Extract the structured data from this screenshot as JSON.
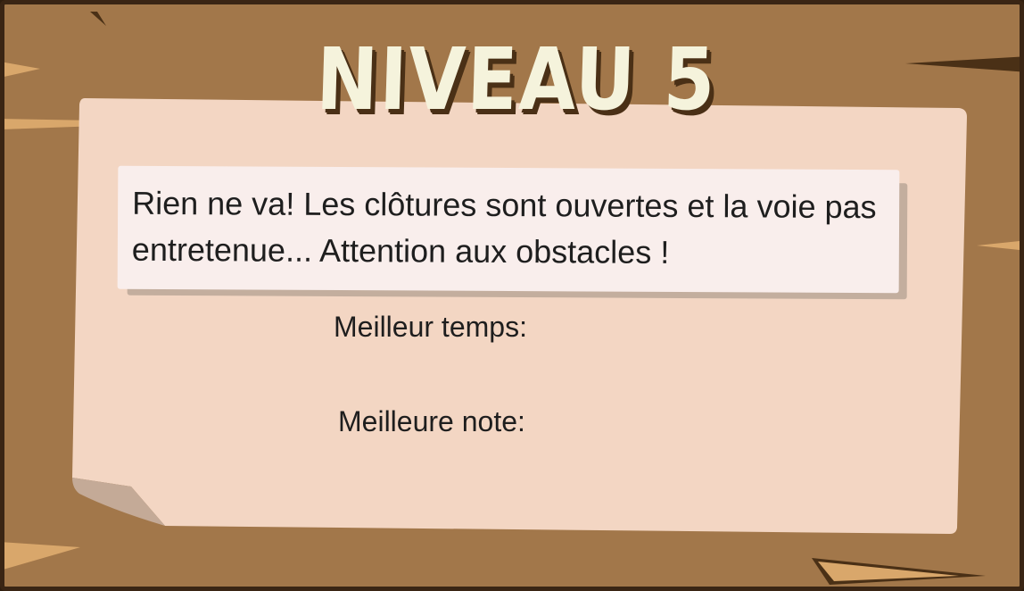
{
  "level": {
    "title": "NIVEAU 5",
    "description": "Rien ne va! Les clôtures sont ouvertes et la voie pas entretenue...  Attention aux obstacles !",
    "best_time_label": "Meilleur temps:",
    "best_score_label": "Meilleure note:"
  },
  "colors": {
    "board": "#a2774a",
    "board_border": "#3a2514",
    "paper": "#f3d6c3",
    "paper_fold": "#c4aa97",
    "note": "#f9eeec",
    "title_fill": "#f5f3dc",
    "title_shadow": "#4a3016",
    "wood_highlight": "#d9a76b"
  }
}
